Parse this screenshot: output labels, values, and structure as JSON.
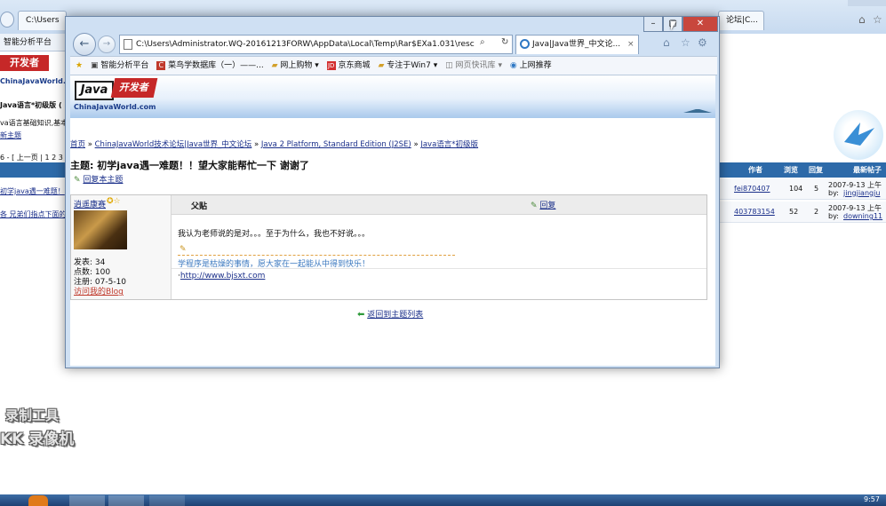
{
  "background_browser": {
    "tab_left": "C:\\Users",
    "tab_right": "论坛|C...",
    "fav_first": "智能分析平台",
    "left_breadcrumb": "Java语言*初级版 (",
    "left_desc": "va语言基础知识,基本",
    "left_new_topic": "新主题",
    "left_pager": "6 - [ 上一页 | 1 2 3",
    "left_row1": "初学java遇一难题！",
    "left_row2": "各 兄弟们指点下面的",
    "col_author": "作者",
    "col_views": "浏览",
    "col_replies": "回复",
    "col_latest": "最新帖子",
    "rows": [
      {
        "author": "fei870407",
        "views": "104",
        "replies": "5",
        "date": "2007-9-13 上午",
        "by": "by:",
        "by_user": "jingjiangju"
      },
      {
        "author": "403783154",
        "views": "52",
        "replies": "2",
        "date": "2007-9-13 上午",
        "by": "by:",
        "by_user": "downing11"
      }
    ],
    "time": "9:57"
  },
  "watermark": {
    "line1": "录制工具",
    "line2": "KK 录像机"
  },
  "popup": {
    "address": "C:\\Users\\Administrator.WQ-20161213FORW\\AppData\\Local\\Temp\\Rar$EXa1.031\\resc",
    "tab_title": "Java|Java世界_中文论...",
    "favorites": [
      "智能分析平台",
      "菜鸟学数据库（一）——...",
      "网上购物",
      "京东商城",
      "专注于Win7",
      "网页快讯库",
      "上网推荐"
    ]
  },
  "page": {
    "logo_text": "Java",
    "logo_badge": "开发者",
    "logo_url": "ChinaJavaWorld.com",
    "breadcrumb": {
      "home": "首页",
      "sep": "»",
      "forum": "ChinaJavaWorld技术论坛|Java世界_中文论坛",
      "section": "Java 2 Platform, Standard Edition (J2SE)",
      "board": "Java语言*初级版"
    },
    "topic_title": "主题: 初学java遇一难题！！望大家能帮忙一下 谢谢了",
    "reply_topic": "回复本主题",
    "post": {
      "author": "逍遥康赛",
      "stats": [
        "发表: 34",
        "点数: 100",
        "注册: 07-5-10"
      ],
      "blog_link": "访问我的Blog",
      "label": "父贴",
      "reply": "回复",
      "body": "我认为老师说的是对。。。至于为什么，我也不好说。。。",
      "signature": "学程序是枯燥的事情，愿大家在一起能从中得到快乐！",
      "sig_link": "http://www.bjsxt.com",
      "sig_prefix": "·"
    },
    "back_link": "返回到主题列表"
  }
}
